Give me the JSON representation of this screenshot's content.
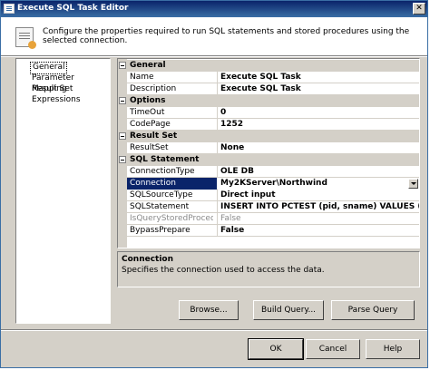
{
  "window": {
    "title": "Execute SQL Task Editor",
    "close_glyph": "✕"
  },
  "header": {
    "description": "Configure the properties required to run SQL statements and stored procedures using the selected connection."
  },
  "nav": {
    "items": [
      "General",
      "Parameter Mapping",
      "Result Set",
      "Expressions"
    ],
    "selected": "General"
  },
  "grid": {
    "categories": {
      "general": "General",
      "options": "Options",
      "result_set": "Result Set",
      "sql_statement": "SQL Statement"
    },
    "rows": {
      "name": {
        "label": "Name",
        "value": "Execute SQL Task"
      },
      "description": {
        "label": "Description",
        "value": "Execute SQL Task"
      },
      "timeout": {
        "label": "TimeOut",
        "value": "0"
      },
      "codepage": {
        "label": "CodePage",
        "value": "1252"
      },
      "resultset": {
        "label": "ResultSet",
        "value": "None"
      },
      "connectiontype": {
        "label": "ConnectionType",
        "value": "OLE DB"
      },
      "connection": {
        "label": "Connection",
        "value": "My2KServer\\Northwind"
      },
      "sqlsourcetype": {
        "label": "SQLSourceType",
        "value": "Direct input"
      },
      "sqlstatement": {
        "label": "SQLStatement",
        "value": "INSERT INTO PCTEST (pid, sname) VALUES (?,?)"
      },
      "isquerystoredprocedure": {
        "label": "IsQueryStoredProcedure",
        "value": "False"
      },
      "bypassprepare": {
        "label": "BypassPrepare",
        "value": "False"
      }
    }
  },
  "description_panel": {
    "title": "Connection",
    "text": "Specifies the connection used to access the data."
  },
  "buttons": {
    "browse": "Browse...",
    "build_query": "Build Query...",
    "parse_query": "Parse Query",
    "ok": "OK",
    "cancel": "Cancel",
    "help": "Help"
  },
  "colors": {
    "title_bar": "#0a246a",
    "selection": "#0a246a",
    "dialog_bg": "#d4d0c8"
  }
}
